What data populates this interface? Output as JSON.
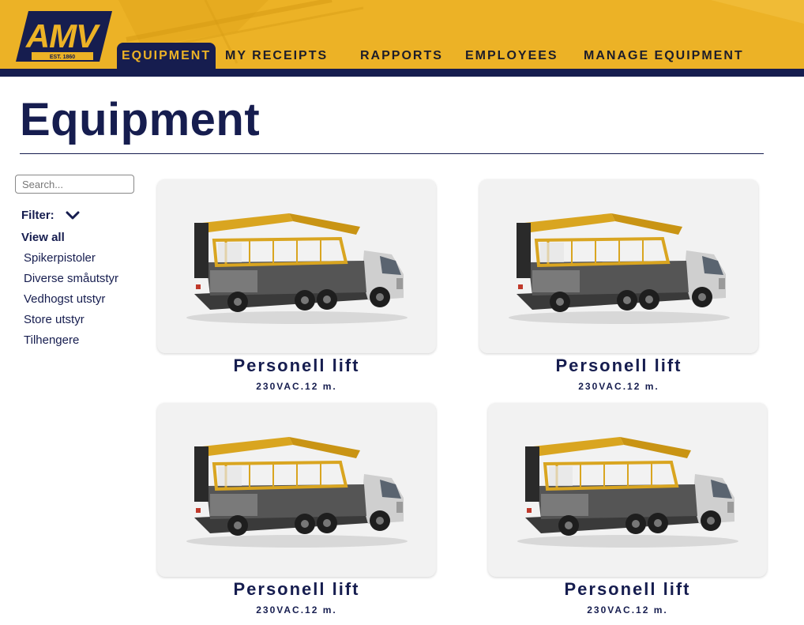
{
  "brand": {
    "logo_text": "AMV",
    "logo_est": "EST. 1860"
  },
  "nav": {
    "items": [
      {
        "label": "EQUIPMENT",
        "active": true
      },
      {
        "label": "MY RECEIPTS",
        "active": false
      },
      {
        "label": "RAPPORTS",
        "active": false
      },
      {
        "label": "EMPLOYEES",
        "active": false
      },
      {
        "label": "MANAGE EQUIPMENT",
        "active": false
      }
    ]
  },
  "page": {
    "title": "Equipment"
  },
  "sidebar": {
    "search_placeholder": "Search...",
    "filter_label": "Filter:",
    "view_all": "View all",
    "categories": [
      "Spikerpistoler",
      "Diverse småutstyr",
      "Vedhogst utstyr",
      "Store utstyr",
      "Tilhengere"
    ]
  },
  "cards": [
    {
      "title": "Personell lift",
      "subtitle": "230VAC.12 m."
    },
    {
      "title": "Personell lift",
      "subtitle": "230VAC.12 m."
    },
    {
      "title": "Personell lift",
      "subtitle": "230VAC.12 m."
    },
    {
      "title": "Personell lift",
      "subtitle": "230VAC.12 m."
    }
  ],
  "colors": {
    "brand_yellow": "#ecb226",
    "brand_navy": "#161d4f",
    "card_bg": "#f2f2f2"
  }
}
